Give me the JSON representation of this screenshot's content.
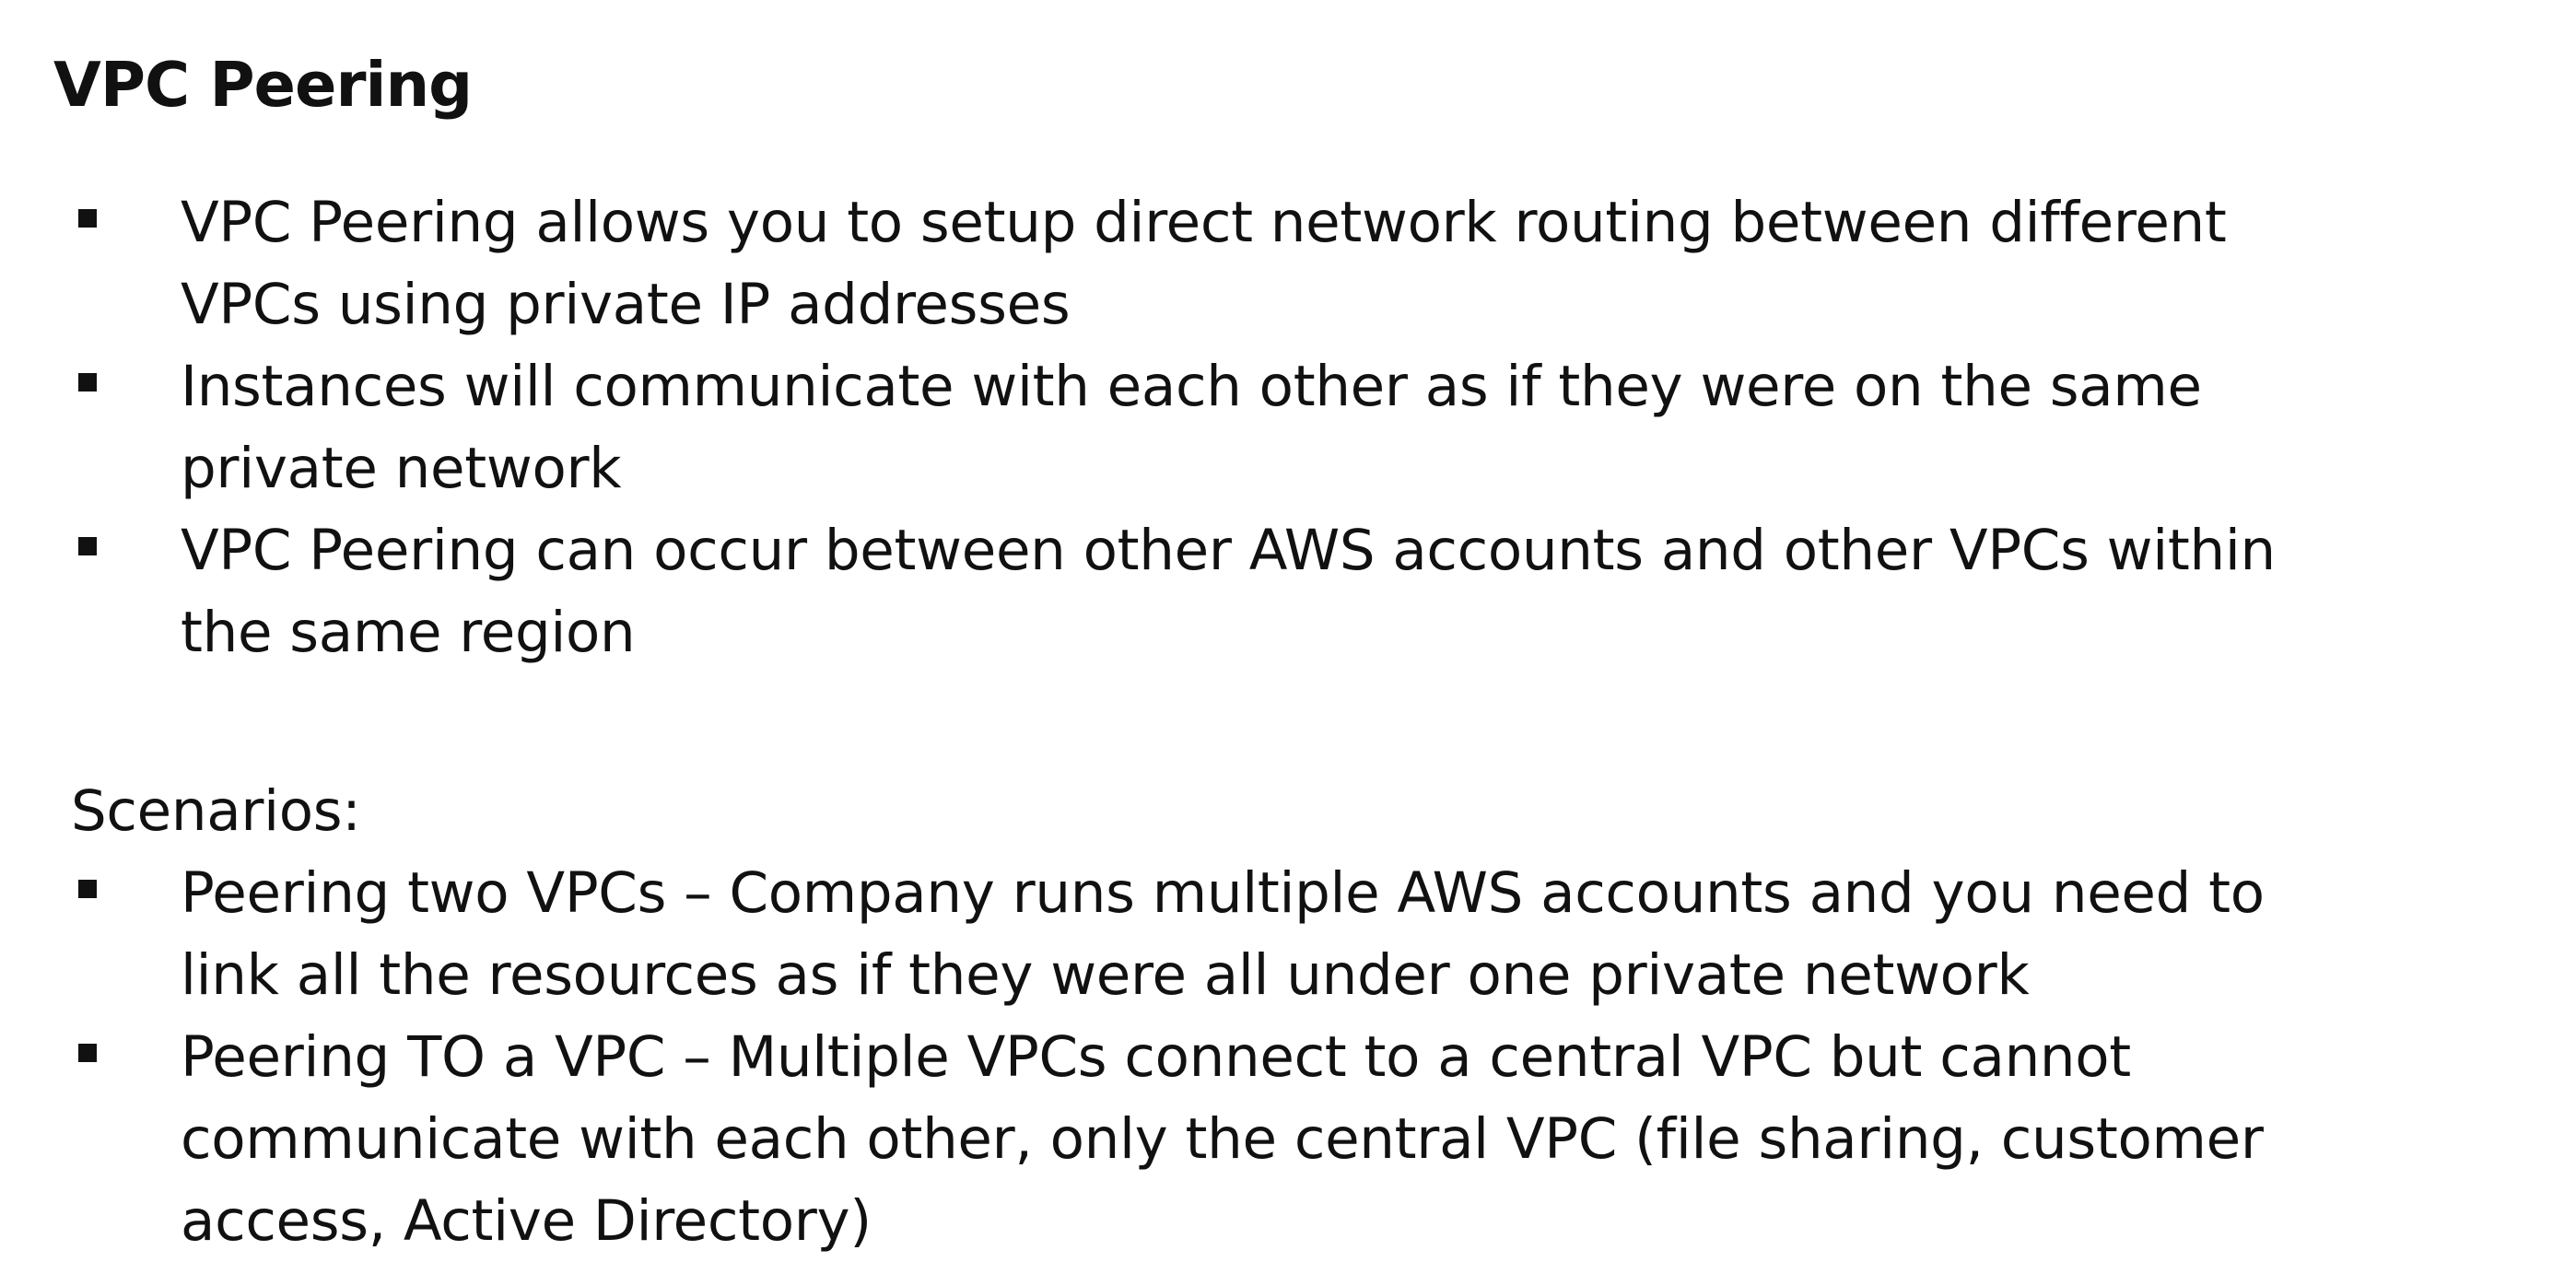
{
  "slide": {
    "title": "VPC Peering",
    "points": [
      {
        "lines": [
          "VPC Peering allows you to setup direct network routing between different",
          "VPCs using private IP addresses"
        ]
      },
      {
        "lines": [
          "Instances will communicate with each other as if they were on the same",
          "private network"
        ]
      },
      {
        "lines": [
          "VPC Peering can occur between other AWS accounts and other VPCs within",
          "the same region"
        ]
      }
    ],
    "scenarios_heading": "Scenarios:",
    "scenarios": [
      {
        "lines": [
          "Peering two VPCs – Company runs multiple AWS accounts and you need to",
          "link all the resources as if they were all under one private network"
        ]
      },
      {
        "lines": [
          "Peering TO a VPC – Multiple VPCs connect to a central VPC but cannot",
          "communicate with each other, only the central VPC (file sharing, customer",
          "access, Active Directory)"
        ]
      }
    ]
  }
}
